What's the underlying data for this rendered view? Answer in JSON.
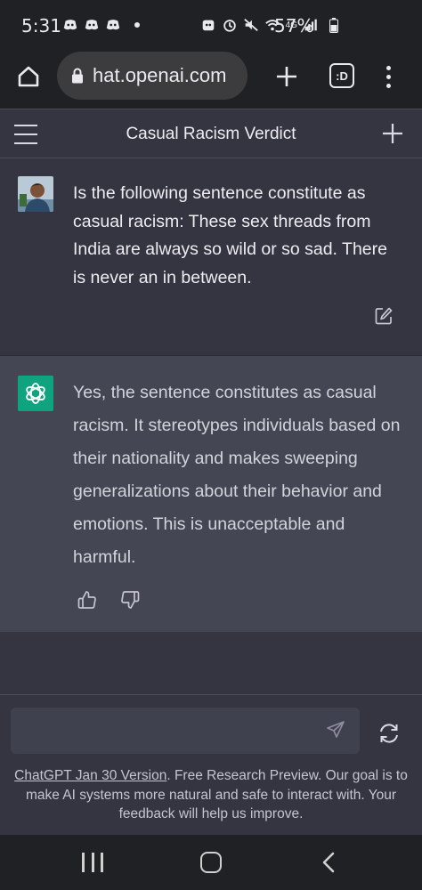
{
  "status_bar": {
    "time": "5:31",
    "network": "4G",
    "battery": "57%"
  },
  "browser": {
    "url": "hat.openai.com",
    "tabs_label": ":D"
  },
  "chat": {
    "title": "Casual Racism Verdict"
  },
  "messages": [
    {
      "role": "user",
      "text": "Is the following sentence constitute as casual racism: These sex threads from India are always so wild or so sad. There is never an in between."
    },
    {
      "role": "assistant",
      "text": "Yes, the sentence constitutes as casual racism. It stereotypes individuals based on their nationality and makes sweeping generalizations about their behavior and emotions. This is unacceptable and harmful."
    }
  ],
  "input": {
    "placeholder": ""
  },
  "footer": {
    "link_text": "ChatGPT Jan 30 Version",
    "note": ". Free Research Preview. Our goal is to make AI systems more natural and safe to interact with. Your feedback will help us improve."
  },
  "colors": {
    "accent": "#10a37f",
    "bg": "#343541",
    "bot_bg": "#444654"
  }
}
